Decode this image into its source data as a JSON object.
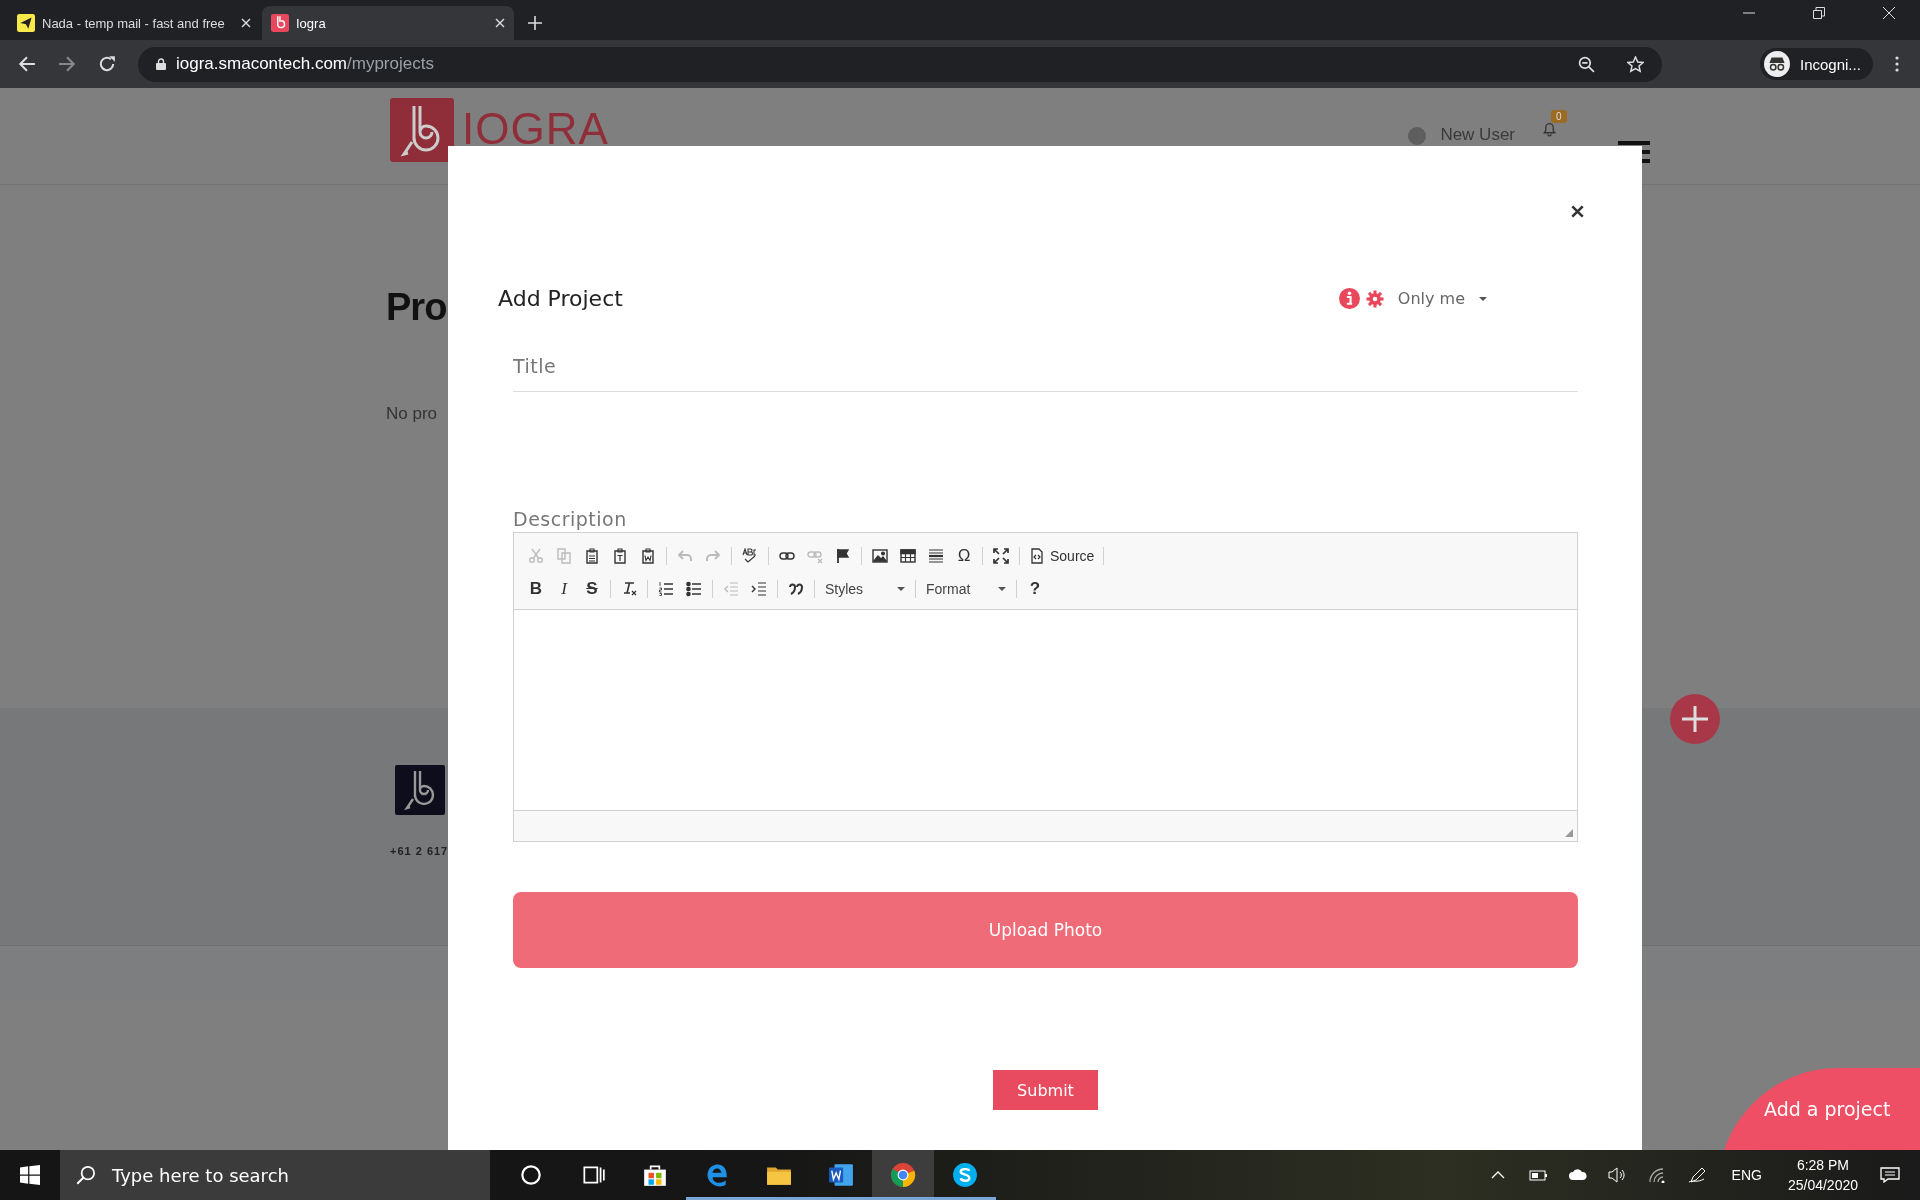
{
  "browser": {
    "tabs": [
      {
        "title": "Nada - temp mail - fast and free",
        "selected": false
      },
      {
        "title": "Iogra",
        "selected": true
      }
    ],
    "url": {
      "host": "iogra.smacontech.com",
      "path": "/myprojects"
    },
    "profile": "Incogni..."
  },
  "page": {
    "logo_text": "IOGRA",
    "notification_count": "0",
    "user": "New User",
    "heading": "Pro",
    "empty_message": "No pro",
    "footer_phone": "+61 2 617",
    "fab_label": "Add a project"
  },
  "modal": {
    "title": "Add Project",
    "visibility": "Only me",
    "title_placeholder": "Title",
    "description_label": "Description",
    "toolbar_rows": [
      [
        {
          "kind": "cut",
          "disabled": true
        },
        {
          "kind": "copy",
          "disabled": true
        },
        {
          "kind": "paste",
          "disabled": false
        },
        {
          "kind": "paste-text",
          "disabled": false
        },
        {
          "kind": "paste-word",
          "disabled": false
        },
        {
          "kind": "separator"
        },
        {
          "kind": "undo",
          "disabled": true
        },
        {
          "kind": "redo",
          "disabled": true
        },
        {
          "kind": "separator"
        },
        {
          "kind": "spellcheck",
          "disabled": false
        },
        {
          "kind": "separator"
        },
        {
          "kind": "link",
          "disabled": false
        },
        {
          "kind": "unlink",
          "disabled": true
        },
        {
          "kind": "flag",
          "disabled": false
        },
        {
          "kind": "separator"
        },
        {
          "kind": "image",
          "disabled": false
        },
        {
          "kind": "table",
          "disabled": false
        },
        {
          "kind": "rule",
          "disabled": false
        },
        {
          "kind": "symbol",
          "label": "Ω",
          "disabled": false
        },
        {
          "kind": "separator"
        },
        {
          "kind": "maximize",
          "disabled": false
        },
        {
          "kind": "separator"
        },
        {
          "kind": "source",
          "label": "Source",
          "disabled": false
        },
        {
          "kind": "separator"
        }
      ],
      [
        {
          "kind": "bold",
          "label": "B",
          "disabled": false
        },
        {
          "kind": "italic",
          "label": "I",
          "disabled": false
        },
        {
          "kind": "strike",
          "label": "S",
          "disabled": false
        },
        {
          "kind": "separator"
        },
        {
          "kind": "clear-format",
          "disabled": false
        },
        {
          "kind": "separator"
        },
        {
          "kind": "numbered-list",
          "disabled": false
        },
        {
          "kind": "bullet-list",
          "disabled": false
        },
        {
          "kind": "separator"
        },
        {
          "kind": "outdent",
          "disabled": true
        },
        {
          "kind": "indent",
          "disabled": false
        },
        {
          "kind": "separator"
        },
        {
          "kind": "quote",
          "disabled": false
        },
        {
          "kind": "separator"
        },
        {
          "kind": "combo",
          "label": "Styles"
        },
        {
          "kind": "separator"
        },
        {
          "kind": "combo",
          "label": "Format"
        },
        {
          "kind": "separator"
        },
        {
          "kind": "help",
          "label": "?",
          "disabled": false
        }
      ]
    ],
    "upload_button": "Upload Photo",
    "submit_button": "Submit"
  },
  "taskbar": {
    "search_placeholder": "Type here to search",
    "apps": [
      {
        "kind": "cortana",
        "running": false,
        "selected": false
      },
      {
        "kind": "task-view",
        "running": false,
        "selected": false
      },
      {
        "kind": "store",
        "running": false,
        "selected": false
      },
      {
        "kind": "edge",
        "running": true,
        "selected": false
      },
      {
        "kind": "folder",
        "running": true,
        "selected": false
      },
      {
        "kind": "word",
        "running": true,
        "selected": false
      },
      {
        "kind": "chrome",
        "running": true,
        "selected": true
      },
      {
        "kind": "skype",
        "running": true,
        "selected": false
      }
    ],
    "language": "ENG",
    "time": "6:28 PM",
    "date": "25/04/2020"
  }
}
